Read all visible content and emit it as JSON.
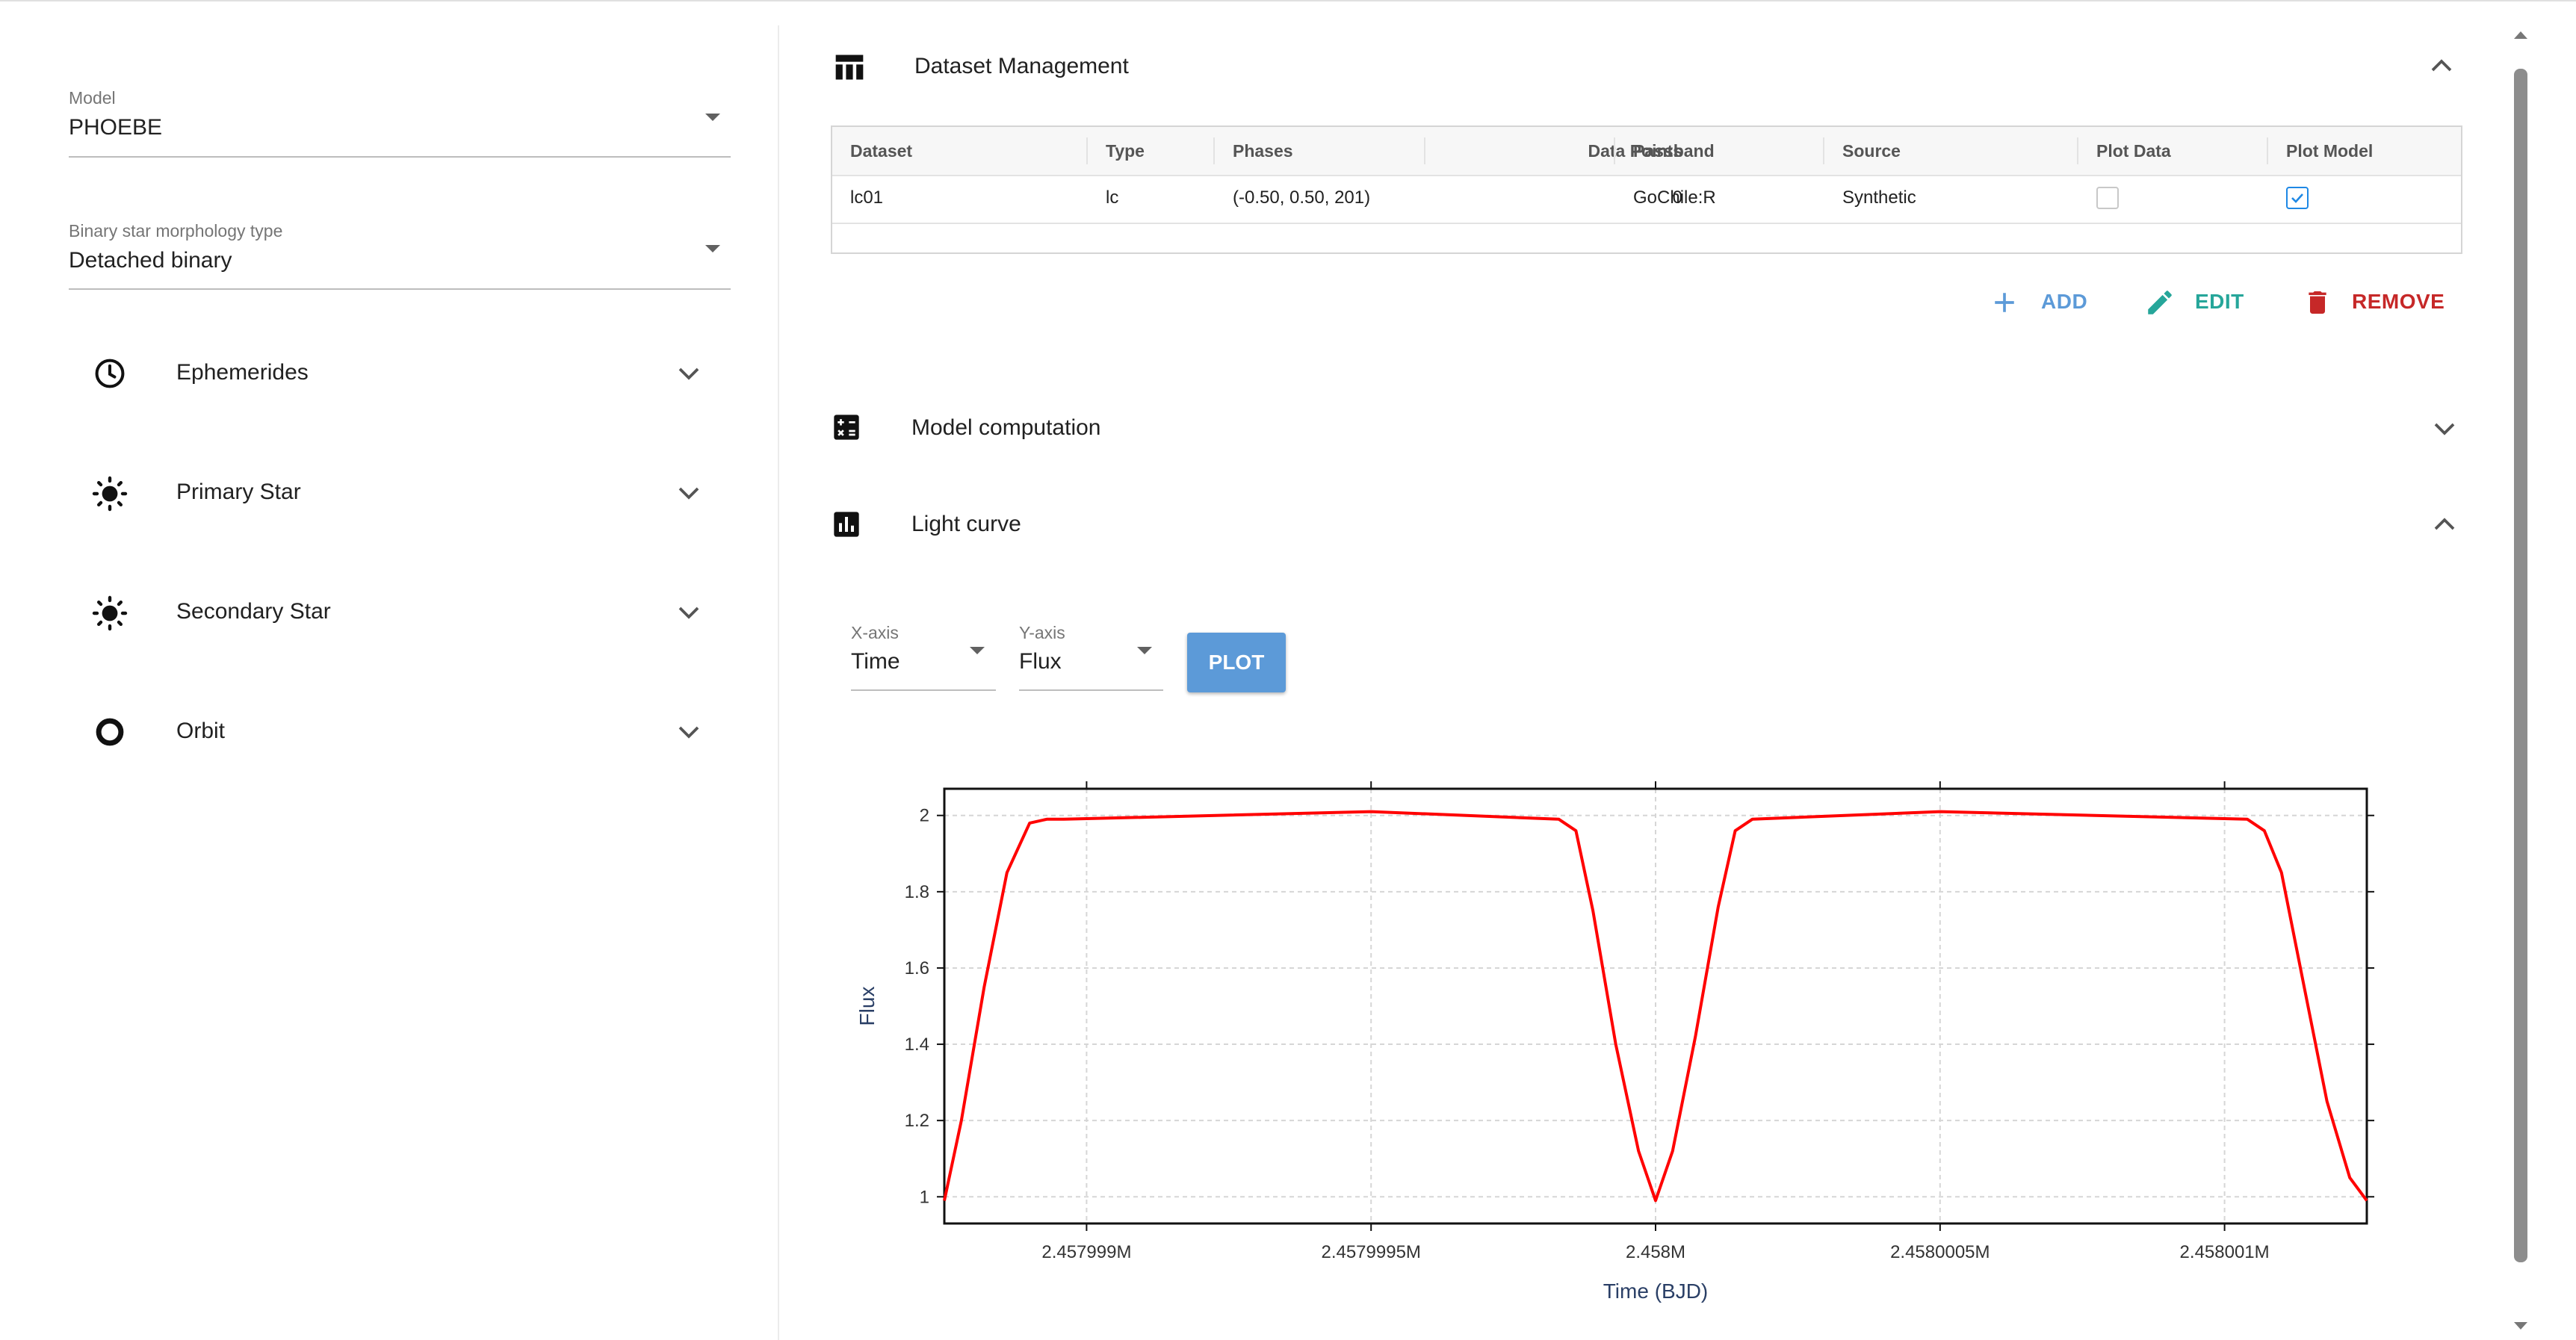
{
  "left_panel": {
    "model": {
      "label": "Model",
      "value": "PHOEBE"
    },
    "morphology": {
      "label": "Binary star morphology type",
      "value": "Detached binary"
    },
    "sections": [
      {
        "label": "Ephemerides",
        "icon": "clock-icon"
      },
      {
        "label": "Primary Star",
        "icon": "sun-icon"
      },
      {
        "label": "Secondary Star",
        "icon": "sun-icon"
      },
      {
        "label": "Orbit",
        "icon": "circle-icon"
      }
    ]
  },
  "dataset_management": {
    "title": "Dataset Management",
    "columns": [
      "Dataset",
      "Type",
      "Phases",
      "Data Points",
      "Passband",
      "Source",
      "Plot Data",
      "Plot Model"
    ],
    "rows": [
      {
        "dataset": "lc01",
        "type": "lc",
        "phases": "(-0.50, 0.50, 201)",
        "data_points": "0",
        "passband": "GoChile:R",
        "source": "Synthetic",
        "plot_data": false,
        "plot_model": true
      }
    ],
    "actions": {
      "add": "ADD",
      "edit": "EDIT",
      "remove": "REMOVE"
    },
    "colors": {
      "add": "#5c9ad8",
      "edit": "#26a69a",
      "remove": "#c62828"
    }
  },
  "model_computation": {
    "title": "Model computation"
  },
  "light_curve": {
    "title": "Light curve",
    "x_axis": {
      "label": "X-axis",
      "value": "Time"
    },
    "y_axis": {
      "label": "Y-axis",
      "value": "Flux"
    },
    "plot_button": "PLOT"
  },
  "chart_data": {
    "type": "line",
    "xlabel": "Time (BJD)",
    "ylabel": "Flux",
    "x_ticks": [
      "2.457999M",
      "2.4579995M",
      "2.458M",
      "2.4580005M",
      "2.458001M"
    ],
    "x_tick_values": [
      2457999.0,
      2457999.5,
      2458000.0,
      2458000.5,
      2458001.0
    ],
    "y_ticks": [
      "1",
      "1.2",
      "1.4",
      "1.6",
      "1.8",
      "2"
    ],
    "y_tick_values": [
      1.0,
      1.2,
      1.4,
      1.6,
      1.8,
      2.0
    ],
    "xlim": [
      2457998.75,
      2458001.25
    ],
    "ylim": [
      0.93,
      2.07
    ],
    "grid": true,
    "series": [
      {
        "color": "#ff0000",
        "x": [
          2457998.75,
          2457998.78,
          2457998.82,
          2457998.86,
          2457998.9,
          2457998.93,
          2457998.96,
          2457999.5,
          2457999.83,
          2457999.86,
          2457999.89,
          2457999.93,
          2457999.97,
          2458000.0,
          2458000.03,
          2458000.07,
          2458000.11,
          2458000.14,
          2458000.17,
          2458000.5,
          2458001.04,
          2458001.07,
          2458001.1,
          2458001.14,
          2458001.18,
          2458001.22,
          2458001.25
        ],
        "y": [
          0.99,
          1.2,
          1.55,
          1.85,
          1.98,
          1.99,
          1.99,
          2.01,
          1.99,
          1.96,
          1.75,
          1.4,
          1.12,
          0.99,
          1.12,
          1.42,
          1.76,
          1.96,
          1.99,
          2.01,
          1.99,
          1.96,
          1.85,
          1.55,
          1.25,
          1.05,
          0.99
        ]
      }
    ]
  }
}
